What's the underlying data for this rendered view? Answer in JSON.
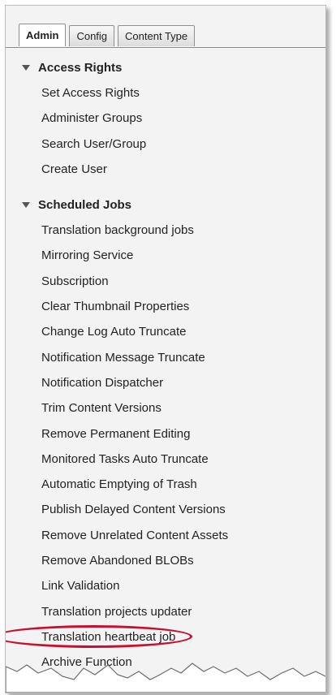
{
  "tabs": [
    {
      "label": "Admin",
      "active": true
    },
    {
      "label": "Config",
      "active": false
    },
    {
      "label": "Content Type",
      "active": false
    }
  ],
  "sections": [
    {
      "title": "Access Rights",
      "items": [
        "Set Access Rights",
        "Administer Groups",
        "Search User/Group",
        "Create User"
      ]
    },
    {
      "title": "Scheduled Jobs",
      "items": [
        "Translation background jobs",
        "Mirroring Service",
        "Subscription",
        "Clear Thumbnail Properties",
        "Change Log Auto Truncate",
        "Notification Message Truncate",
        "Notification Dispatcher",
        "Trim Content Versions",
        "Remove Permanent Editing",
        "Monitored Tasks Auto Truncate",
        "Automatic Emptying of Trash",
        "Publish Delayed Content Versions",
        "Remove Unrelated Content Assets",
        "Remove Abandoned BLOBs",
        "Link Validation",
        "Translation projects updater",
        "Translation heartbeat job",
        "Archive Function"
      ]
    }
  ],
  "highlight_color": "#c8102e"
}
